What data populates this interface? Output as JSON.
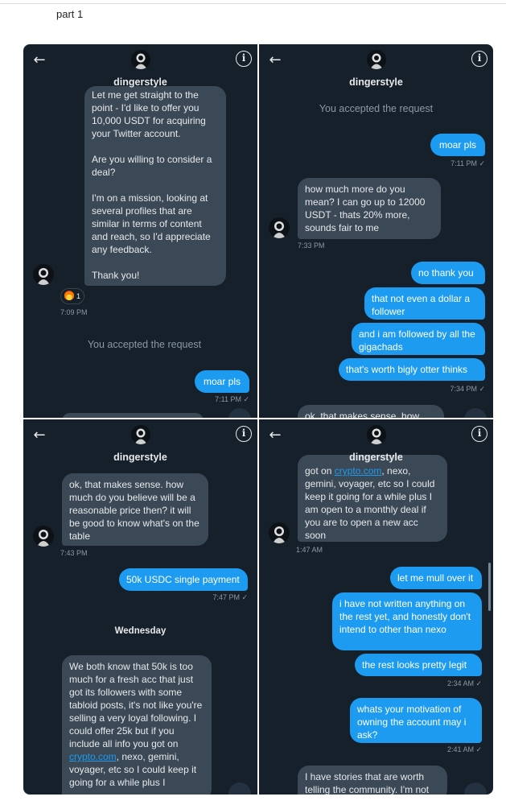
{
  "caption": "part 1",
  "header": {
    "username": "dingerstyle"
  },
  "panel1": {
    "message_main": "Let me get straight to the point - I'd like to offer you 10,000 USDT for acquiring your Twitter account.\n\nAre you willing to consider a deal?\n\nI'm on a mission, looking at several profiles that are similar in terms of content and reach, so I'd appreciate any feedback.\n\nThank you!",
    "reaction_count": "1",
    "time_in": "7:09 PM",
    "accepted": "You accepted the request",
    "reply": "moar pls",
    "reply_time": "7:11 PM ✓"
  },
  "panel2": {
    "accepted": "You accepted the request",
    "reply": "moar pls",
    "reply_time": "7:11 PM ✓",
    "offer": "how much more do you mean? I can go up to 12000 USDT - thats 20% more, sounds fair to me",
    "offer_time": "7:33 PM",
    "out1": "no thank you",
    "out2": "that not even a dollar a follower",
    "out3": "and i am followed by all the gigachads",
    "out4": "that's worth bigly otter thinks",
    "out_time": "7:34 PM ✓",
    "peek": "ok, that makes sense. how"
  },
  "panel3": {
    "in1": "ok, that makes sense. how much do you believe will be a reasonable price then? it will be good to know what's on the table",
    "in1_time": "7:43 PM",
    "out1": "50k USDC single payment",
    "out1_time": "7:47 PM ✓",
    "day": "Wednesday",
    "in2_a": "We both know that 50k is too much for a fresh acc that just got its followers with some tabloid posts, it's not like you're selling a very loyal following. I could offer 25k but if you include all info you got on ",
    "in2_link": "crypto.com",
    "in2_b": ", nexo, gemini, voyager, etc so I could keep it going for a while plus I"
  },
  "panel4": {
    "in1_pre": "got on ",
    "in1_link": "crypto.com",
    "in1_post": ", nexo, gemini, voyager, etc so I could keep it going for a while plus I am open to a monthly deal if you are to open a new acc soon",
    "in1_time": "1:47 AM",
    "out1": "let me mull over it",
    "out2": "i have not written anything on the rest yet, and honestly don't intend to other than nexo",
    "out3": "the rest looks pretty legit",
    "out3_time": "2:34 AM ✓",
    "out4": "whats your motivation of owning the account may i ask?",
    "out4_time": "2:41 AM ✓",
    "in2": "I have stories that are worth telling the community. I'm not"
  },
  "icons": [
    "back-arrow-icon",
    "info-icon",
    "avatar",
    "fire-emoji-icon"
  ]
}
